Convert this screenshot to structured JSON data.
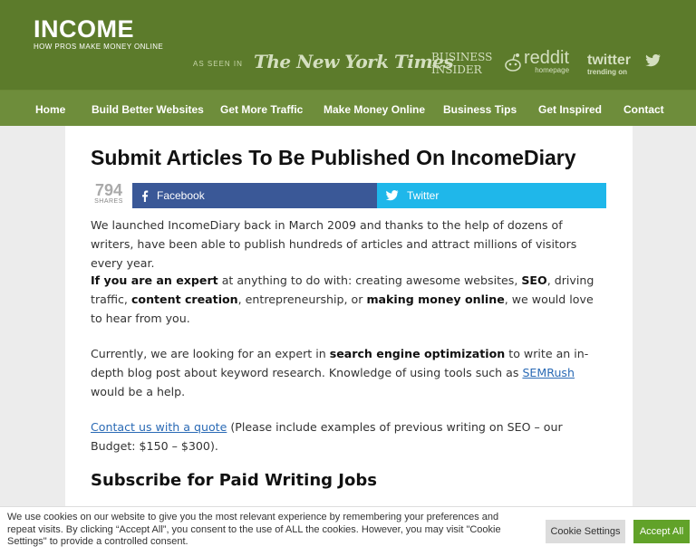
{
  "header": {
    "logo_title": "INCOME",
    "logo_tagline": "HOW PROS MAKE MONEY ONLINE",
    "as_seen_in": "AS SEEN IN",
    "media": {
      "nyt": "The New York Times",
      "bi_line1": "BUSINESS",
      "bi_line2": "INSIDER",
      "reddit": "reddit",
      "reddit_sub": "homepage",
      "twitter": "twitter",
      "twitter_sub": "trending on"
    }
  },
  "nav": {
    "items": [
      {
        "label": "Home"
      },
      {
        "label": "Build Better Websites"
      },
      {
        "label": "Get More Traffic"
      },
      {
        "label": "Make Money Online"
      },
      {
        "label": "Business Tips"
      },
      {
        "label": "Get Inspired"
      },
      {
        "label": "Contact"
      }
    ]
  },
  "article": {
    "title": "Submit Articles To Be Published On IncomeDiary",
    "shares_count": "794",
    "shares_label": "SHARES",
    "facebook_label": "Facebook",
    "twitter_label": "Twitter",
    "p1": "We launched IncomeDiary back in March 2009 and thanks to the help of dozens of writers, have been able to publish hundreds of articles and attract millions of visitors every year.",
    "p2": {
      "b1": "If you are an expert",
      "t1": " at anything to do with: creating awesome websites, ",
      "b2": "SEO",
      "t2": ", driving traffic, ",
      "b3": "content creation",
      "t3": ", entrepreneurship, or ",
      "b4": "making money online",
      "t4": ", we would love to hear from you."
    },
    "p3": {
      "t1": "Currently, we are looking for an expert in ",
      "b1": "search engine optimization",
      "t2": " to write an in-depth blog post about keyword research. Knowledge of using tools such as ",
      "link": "SEMRush",
      "t3": " would be a help."
    },
    "p4": {
      "link": "Contact us with a quote",
      "t1": " (Please include examples of previous writing on SEO – our Budget: $150 – $300)."
    },
    "subheading": "Subscribe for Paid Writing Jobs"
  },
  "cookie": {
    "text": "We use cookies on our website to give you the most relevant experience by remembering your preferences and repeat visits. By clicking “Accept All”, you consent to the use of ALL the cookies. However, you may visit \"Cookie Settings\" to provide a controlled consent.",
    "settings_label": "Cookie Settings",
    "accept_label": "Accept All"
  },
  "colors": {
    "header_bg": "#5c7b2b",
    "nav_bg": "#6e8d3b",
    "facebook": "#3a5897",
    "twitter": "#1fb7ea",
    "accept": "#61a229"
  }
}
